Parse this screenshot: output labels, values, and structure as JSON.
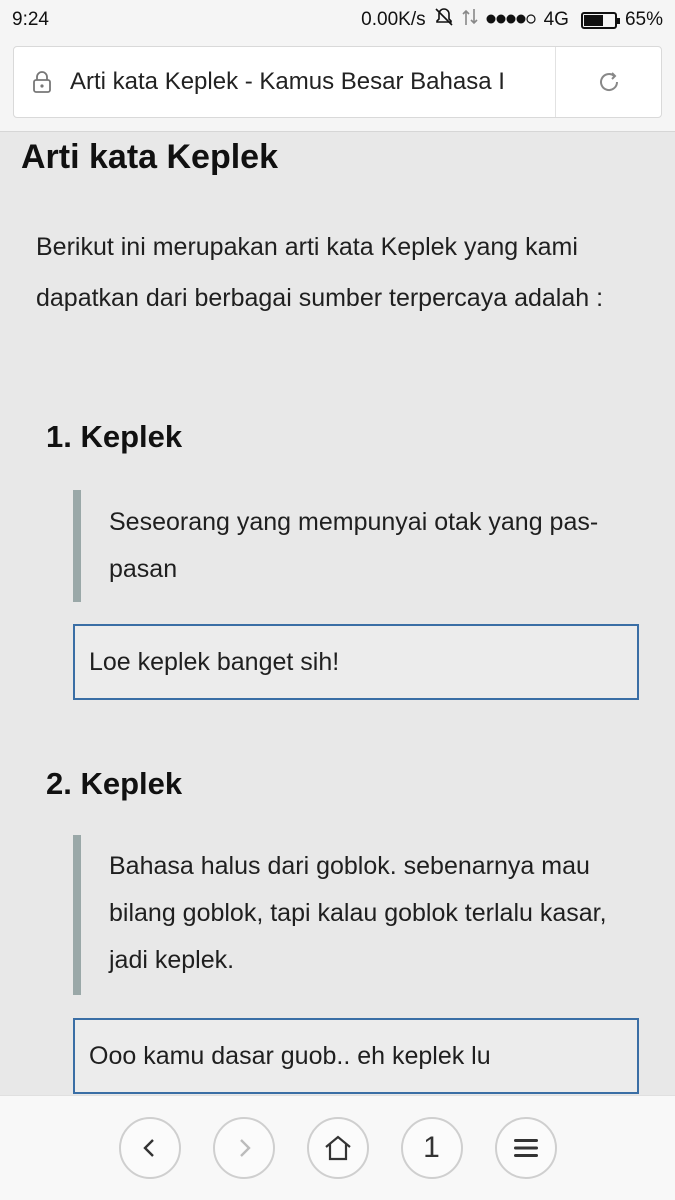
{
  "status_bar": {
    "time": "9:24",
    "speed": "0.00K/s",
    "network": "4G",
    "battery_percent": "65%",
    "battery_level": 0.65
  },
  "address_bar": {
    "title": "Arti kata Keplek - Kamus Besar Bahasa I"
  },
  "article": {
    "title": "Arti kata Keplek",
    "intro": "Berikut ini merupakan arti kata Keplek yang kami dapatkan dari berbagai sumber terpercaya adalah :",
    "entries": [
      {
        "heading": "1. Keplek",
        "definition": "Seseorang yang mempunyai otak yang pas-pasan",
        "example": "Loe keplek banget sih!"
      },
      {
        "heading": "2. Keplek",
        "definition": "Bahasa halus dari goblok. sebenarnya mau bilang goblok, tapi kalau goblok terlalu kasar, jadi keplek.",
        "example": "Ooo kamu dasar guob.. eh keplek lu"
      }
    ]
  },
  "bottom_nav": {
    "tab_count": "1"
  }
}
